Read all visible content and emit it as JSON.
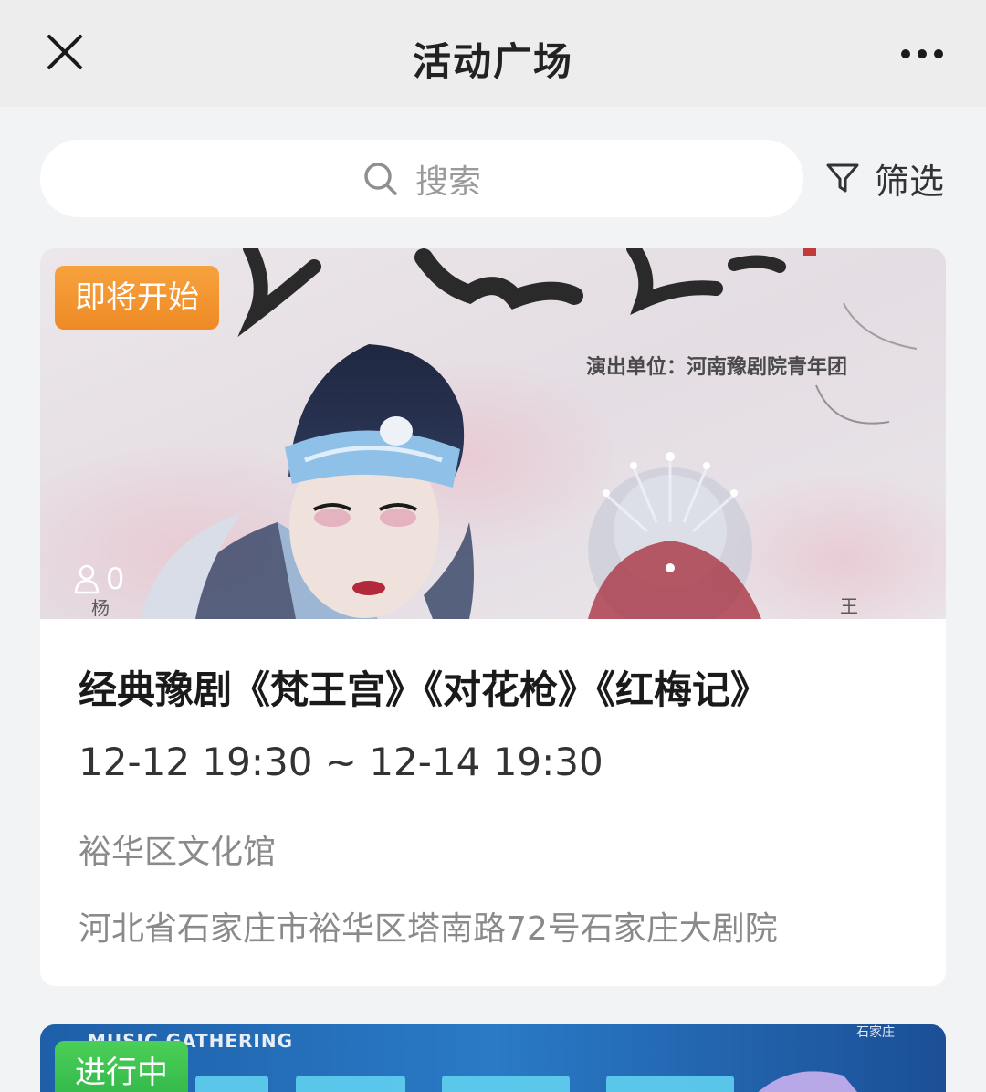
{
  "header": {
    "title": "活动广场",
    "close_icon": "close-icon",
    "more_icon": "more-dots-icon"
  },
  "search": {
    "placeholder": "搜索",
    "icon": "search-icon"
  },
  "filter": {
    "label": "筛选",
    "icon": "funnel-icon"
  },
  "events": [
    {
      "status": "即将开始",
      "status_color": "#f29632",
      "participants": "0",
      "poster_text": {
        "performer_line": "演出单位：河南豫剧院青年团",
        "left_mark": "杨",
        "right_mark": "王"
      },
      "title": "经典豫剧《梵王宫》《对花枪》《红梅记》",
      "time": "12-12 19:30 ~ 12-14 19:30",
      "organizer": "裕华区文化馆",
      "address": "河北省石家庄市裕华区塔南路72号石家庄大剧院"
    },
    {
      "status": "进行中",
      "status_color": "#3cbf4f",
      "poster_text": {
        "tag": "MUSIC GATHERING",
        "corner": "石家庄"
      }
    }
  ],
  "colors": {
    "page_bg": "#f2f3f5",
    "topbar_bg": "#ededed",
    "card_bg": "#ffffff",
    "muted_text": "#8a8a8a"
  }
}
